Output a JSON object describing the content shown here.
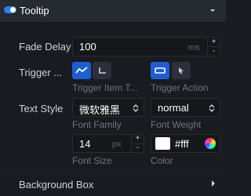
{
  "panel": {
    "title": "Tooltip",
    "enabled": true
  },
  "fade_delay": {
    "label": "Fade Delay",
    "value": "100",
    "unit": "ms",
    "step_up": "+",
    "step_down": "-"
  },
  "trigger": {
    "label": "Trigger ...",
    "item_caption": "Trigger Item T...",
    "action_caption": "Trigger Action",
    "item_options": [
      {
        "icon": "line-chart-icon",
        "selected": true
      },
      {
        "icon": "axis-icon",
        "selected": false
      }
    ],
    "action_options": [
      {
        "icon": "mousemove-icon",
        "selected": true
      },
      {
        "icon": "click-pointer-icon",
        "selected": false
      }
    ]
  },
  "text_style": {
    "label": "Text Style",
    "font_family": "微软雅黑",
    "font_family_caption": "Font Family",
    "font_weight": "normal",
    "font_weight_caption": "Font Weight",
    "font_size": "14",
    "font_size_unit": "px",
    "font_size_caption": "Font Size",
    "step_up": "+",
    "step_down": "-",
    "color": "#fff",
    "color_caption": "Color",
    "color_swatch": "#ffffff"
  },
  "background_box": {
    "label": "Background Box"
  },
  "colors": {
    "accent": "#1d5fd1",
    "toggle_on": "#2a7fff",
    "background": "#191b20",
    "header": "#262a31"
  }
}
